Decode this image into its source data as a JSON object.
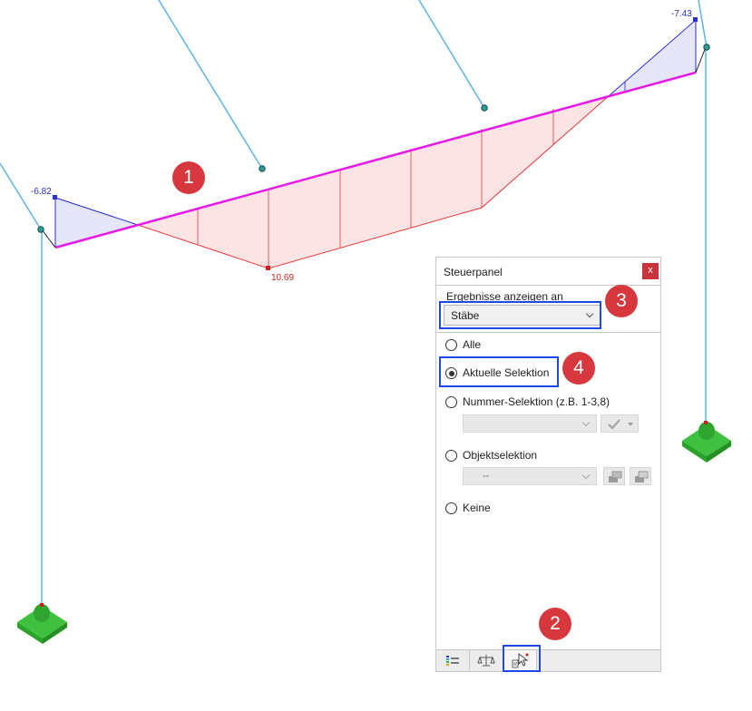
{
  "model_view": {
    "result_values": {
      "left_end_negative": "-6.82",
      "right_end_negative": "-7.43",
      "max_positive": "10.69"
    },
    "colors": {
      "member": "#e619e6",
      "positive_fill": "#fde4e4",
      "positive_line": "#e23a3a",
      "negative_fill": "#e6e6fb",
      "negative_line": "#2a2fd0",
      "column": "#5ab4e6",
      "support": "#2fbd2f"
    }
  },
  "panel": {
    "title": "Steuerpanel",
    "close_label": "x",
    "section_label": "Ergebnisse anzeigen an",
    "show_on_value": "Stäbe",
    "options": {
      "alle": "Alle",
      "aktuelle": "Aktuelle Selektion",
      "nummer": "Nummer-Selektion (z.B. 1-3,8)",
      "objekt": "Objektselektion",
      "keine": "Keine"
    },
    "selected_option": "Aktuelle Selektion",
    "objekt_dropdown_value": "--",
    "tabs": [
      "color-scale-icon",
      "balance-icon",
      "select-filter-icon"
    ]
  },
  "badges": [
    "1",
    "2",
    "3",
    "4"
  ]
}
